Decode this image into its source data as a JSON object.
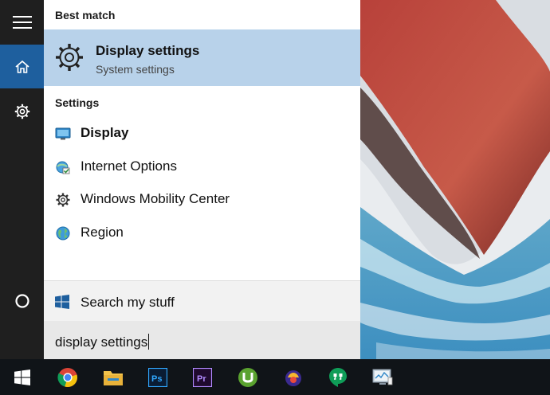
{
  "start_menu": {
    "best_match_header": "Best match",
    "best_match": {
      "title": "Display settings",
      "subtitle": "System settings",
      "icon": "gear-icon"
    },
    "settings_header": "Settings",
    "settings_items": [
      {
        "label": "Display",
        "icon": "display-icon"
      },
      {
        "label": "Internet Options",
        "icon": "internet-options-icon"
      },
      {
        "label": "Windows Mobility Center",
        "icon": "mobility-center-icon"
      },
      {
        "label": "Region",
        "icon": "globe-icon"
      }
    ],
    "search_my_stuff": "Search my stuff",
    "search_query": "display settings"
  },
  "rail": {
    "items": [
      "hamburger-menu-icon",
      "home-icon",
      "settings-icon",
      "cortana-icon"
    ]
  },
  "taskbar": {
    "items": [
      "windows-start-icon",
      "chrome-icon",
      "file-explorer-icon",
      "photoshop-icon",
      "premiere-icon",
      "utorrent-icon",
      "app-icon",
      "hangouts-icon",
      "system-monitor-icon"
    ]
  },
  "colors": {
    "highlight": "#b8d2ea",
    "accent": "#1e5f9e",
    "rail": "#1f1f1f",
    "taskbar": "#101418"
  }
}
